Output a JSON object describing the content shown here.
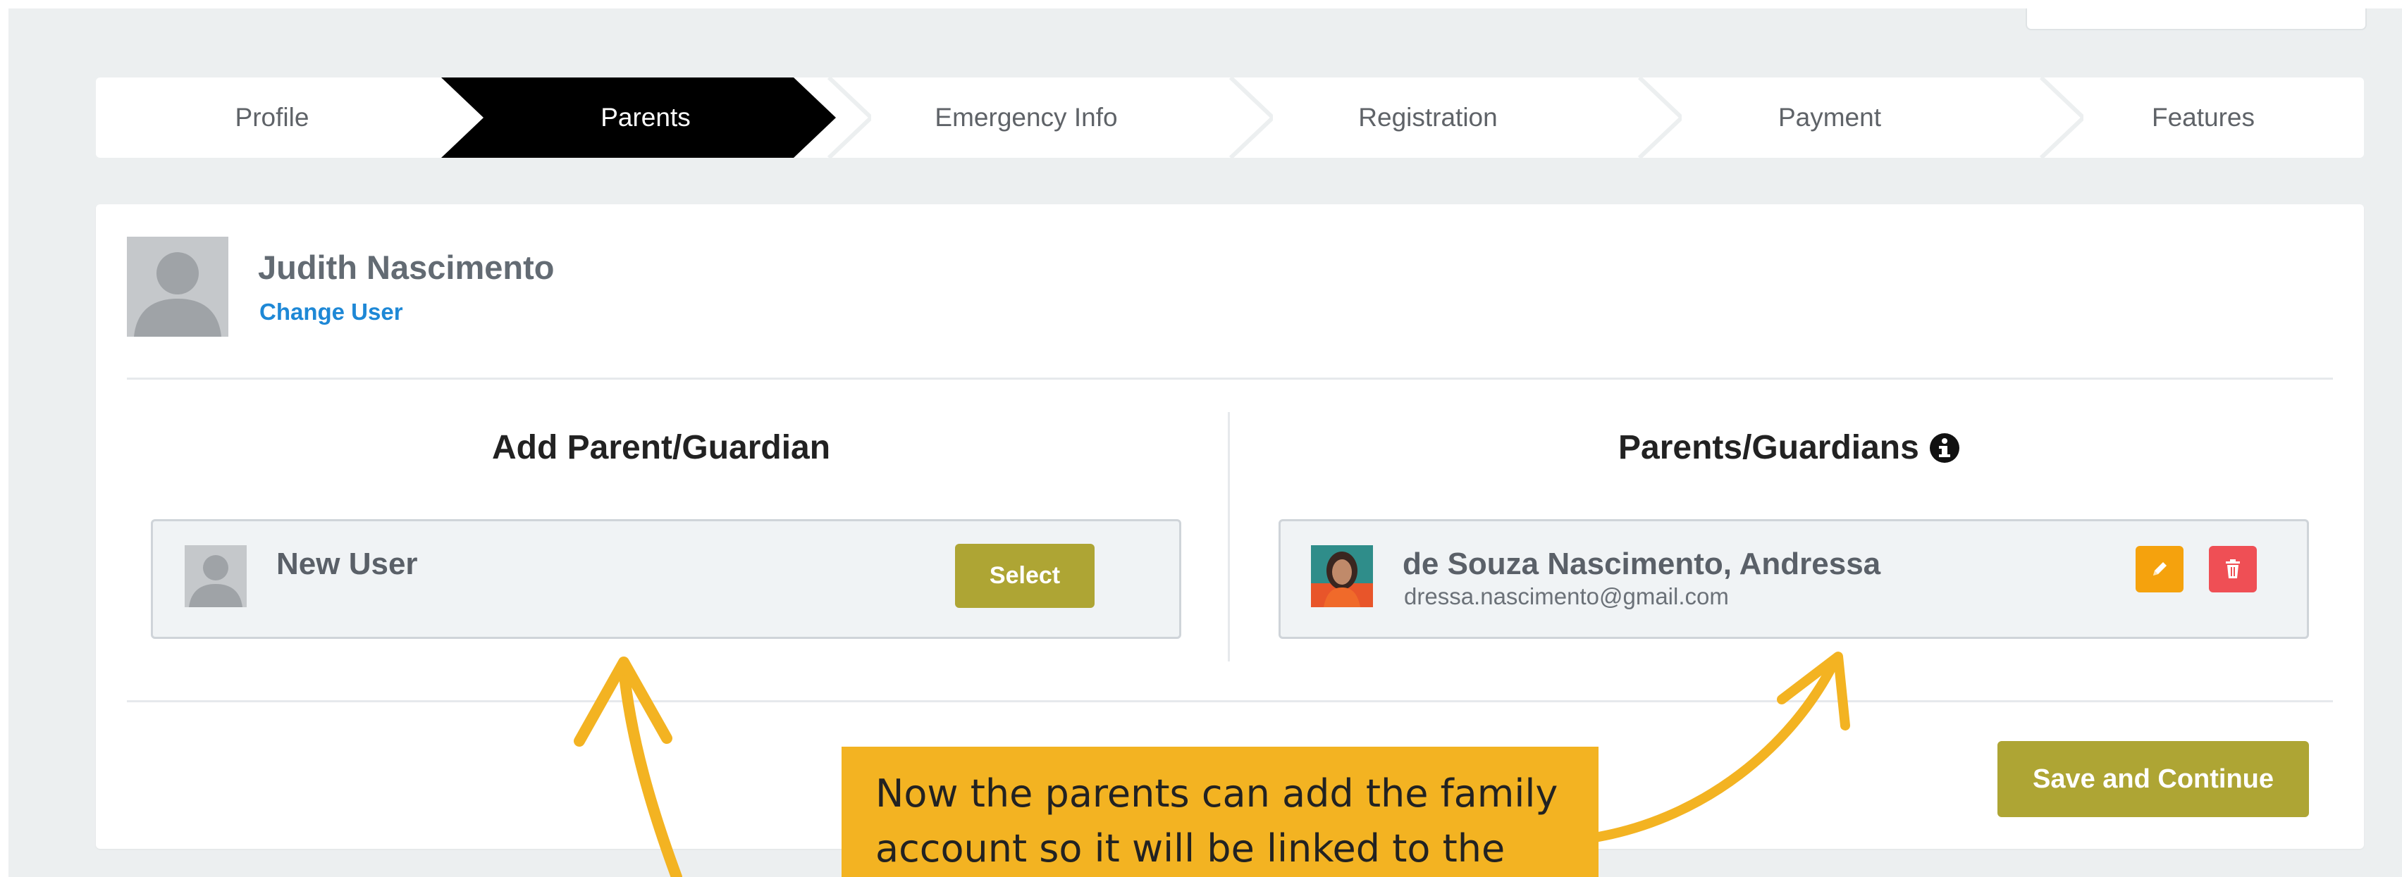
{
  "stepper": {
    "steps": [
      {
        "label": "Profile",
        "active": false
      },
      {
        "label": "Parents",
        "active": true
      },
      {
        "label": "Emergency Info",
        "active": false
      },
      {
        "label": "Registration",
        "active": false
      },
      {
        "label": "Payment",
        "active": false
      },
      {
        "label": "Features",
        "active": false
      }
    ]
  },
  "user": {
    "name": "Judith Nascimento",
    "change_label": "Change User"
  },
  "add_section": {
    "title": "Add Parent/Guardian",
    "new_user_label": "New User",
    "select_label": "Select"
  },
  "parents_section": {
    "title": "Parents/Guardians",
    "info_icon": "info-circle-icon",
    "parents": [
      {
        "name": "de Souza Nascimento, Andressa",
        "email": "dressa.nascimento@gmail.com"
      }
    ]
  },
  "actions": {
    "save_label": "Save and Continue"
  },
  "annotation": {
    "text_line1": "Now the parents can add the family",
    "text_line2": "account so it will be linked to the"
  },
  "colors": {
    "active_step": "#000000",
    "olive_button": "#aea534",
    "edit_button": "#f5a20d",
    "delete_button": "#ef4f55",
    "callout": "#f3b322",
    "link": "#1e88d6"
  }
}
